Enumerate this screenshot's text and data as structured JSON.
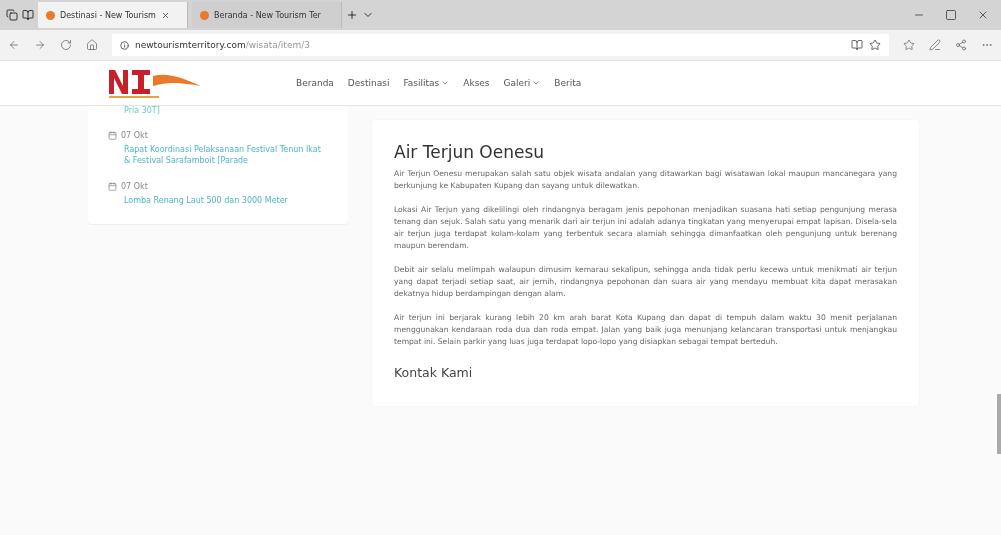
{
  "browser": {
    "tabs": [
      {
        "label": "Destinasi - New Tourism",
        "selected": true
      },
      {
        "label": "Beranda - New Tourism Ter",
        "selected": false
      }
    ],
    "url_host": "newtourismterritory.com",
    "url_path": "/wisata/item/3"
  },
  "navbar": {
    "links": [
      {
        "label": "Beranda",
        "dropdown": false
      },
      {
        "label": "Destinasi",
        "dropdown": false
      },
      {
        "label": "Fasilitas",
        "dropdown": true
      },
      {
        "label": "Akses",
        "dropdown": false
      },
      {
        "label": "Galeri",
        "dropdown": true
      },
      {
        "label": "Berita",
        "dropdown": false
      }
    ]
  },
  "sidebar": {
    "cut_text": "Pria 30T]",
    "news": [
      {
        "date": "07 Okt",
        "title": "Rapat Koordinasi Pelaksanaan Festival Tenun Ikat & Festival Sarafamboit [Parade"
      },
      {
        "date": "07 Okt",
        "title": "Lomba Renang Laut 500 dan 3000 Meter"
      }
    ]
  },
  "article": {
    "title": "Air Terjun Oenesu",
    "paragraphs": [
      "Air Terjun Oenesu merupakan salah satu objek wisata andalan yang ditawarkan bagi wisatawan lokal maupun mancanegara yang berkunjung ke Kabupaten Kupang dan sayang untuk dilewatkan.",
      "Lokasi Air Terjun yang dikelilingi oleh rindangnya beragam jenis pepohonan menjadikan suasana hati setiap pengunjung merasa tenang dan sejuk. Salah satu yang menarik dari air terjun ini adalah adanya tingkatan yang menyerupai empat lapisan. Disela-sela air terjun juga terdapat kolam-kolam yang terbentuk secara alamiah sehingga dimanfaatkan oleh pengunjung untuk berenang maupun berendam.",
      "Debit air selalu melimpah walaupun dimusim kemarau sekalipun, sehingga anda tidak perlu kecewa untuk menikmati air terjun yang dapat terjadi setiap saat, air jernih, rindangnya pepohonan dan suara air yang mendayu membuat kita dapat merasakan dekatnya hidup berdampingan dengan alam.",
      "Air terjun ini berjarak kurang lebih 20 km arah barat Kota Kupang dan dapat di tempuh dalam waktu 30 menit perjalanan menggunakan kendaraan roda dua dan roda empat. Jalan yang baik juga menunjang kelancaran transportasi untuk menjangkau tempat ini. Selain parkir yang luas juga terdapat lopo-lopo yang disiapkan sebagai tempat berteduh."
    ],
    "subtitle": "Kontak Kami"
  }
}
